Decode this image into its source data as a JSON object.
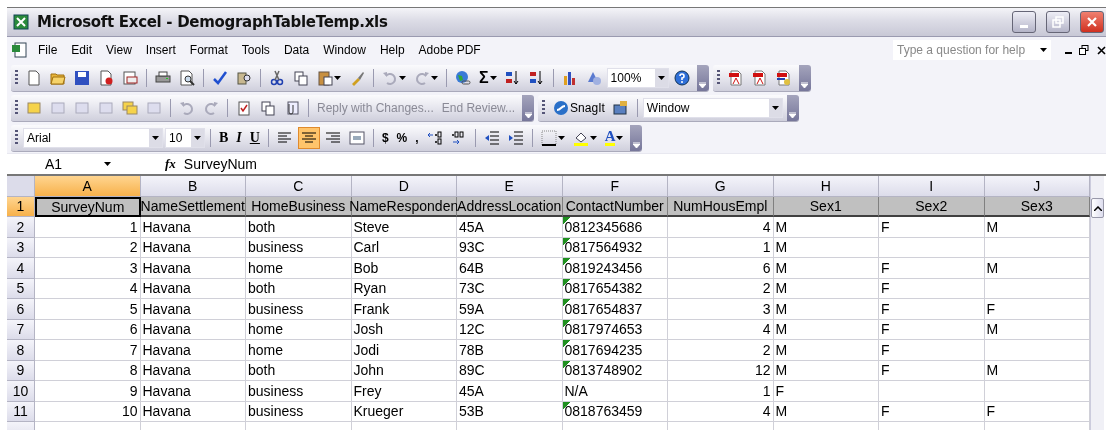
{
  "window": {
    "title": "Microsoft Excel - DemographTableTemp.xls"
  },
  "menu": {
    "items": [
      "File",
      "Edit",
      "View",
      "Insert",
      "Format",
      "Tools",
      "Data",
      "Window",
      "Help",
      "Adobe PDF"
    ],
    "help_search": {
      "placeholder": "Type a question for help"
    }
  },
  "standard_toolbar": {
    "sum": "Σ",
    "zoom": "100%"
  },
  "reviewing_toolbar": {
    "reply": "Reply with Changes...",
    "end_review": "End Review..."
  },
  "snagit_toolbar": {
    "label": "SnagIt",
    "capture_mode": "Window"
  },
  "formatting_toolbar": {
    "font": "Arial",
    "size": "10",
    "bold": "B",
    "italic": "I",
    "underline": "U",
    "alignment": [
      {
        "selected": false
      },
      {
        "selected": true
      },
      {
        "selected": false
      }
    ],
    "currency": "$",
    "percent": "%",
    "comma": ",",
    "font_color": "A"
  },
  "formula_bar": {
    "name_box": "A1",
    "function_label": "fx",
    "value": "SurveyNum"
  },
  "sheet": {
    "columns": [
      {
        "label": "A",
        "selected": true,
        "numeric": true
      },
      {
        "label": "B",
        "selected": false,
        "numeric": false
      },
      {
        "label": "C",
        "selected": false,
        "numeric": false
      },
      {
        "label": "D",
        "selected": false,
        "numeric": false
      },
      {
        "label": "E",
        "selected": false,
        "numeric": false
      },
      {
        "label": "F",
        "selected": false,
        "numeric": false
      },
      {
        "label": "G",
        "selected": false,
        "numeric": true
      },
      {
        "label": "H",
        "selected": false,
        "numeric": false
      },
      {
        "label": "I",
        "selected": false,
        "numeric": false
      },
      {
        "label": "J",
        "selected": false,
        "numeric": false
      }
    ],
    "rows": [
      {
        "number": "1",
        "selected": true,
        "kind": "header",
        "number_stored_as_text": false,
        "cells": [
          "SurveyNum",
          "NameSettlement",
          "HomeBusiness",
          "NameResponden",
          "AddressLocation",
          "ContactNumber",
          "NumHousEmpl",
          "Sex1",
          "Sex2",
          "Sex3"
        ]
      },
      {
        "number": "2",
        "selected": false,
        "kind": "data",
        "number_stored_as_text": true,
        "cells": [
          "1",
          "Havana",
          "both",
          "Steve",
          "45A",
          "0812345686",
          "4",
          "M",
          "F",
          "M"
        ]
      },
      {
        "number": "3",
        "selected": false,
        "kind": "data",
        "number_stored_as_text": true,
        "cells": [
          "2",
          "Havana",
          "business",
          "Carl",
          "93C",
          "0817564932",
          "1",
          "M",
          "",
          ""
        ]
      },
      {
        "number": "4",
        "selected": false,
        "kind": "data",
        "number_stored_as_text": true,
        "cells": [
          "3",
          "Havana",
          "home",
          "Bob",
          "64B",
          "0819243456",
          "6",
          "M",
          "F",
          "M"
        ]
      },
      {
        "number": "5",
        "selected": false,
        "kind": "data",
        "number_stored_as_text": true,
        "cells": [
          "4",
          "Havana",
          "both",
          "Ryan",
          "73C",
          "0817654382",
          "2",
          "M",
          "F",
          ""
        ]
      },
      {
        "number": "6",
        "selected": false,
        "kind": "data",
        "number_stored_as_text": true,
        "cells": [
          "5",
          "Havana",
          "business",
          "Frank",
          "59A",
          "0817654837",
          "3",
          "M",
          "F",
          "F"
        ]
      },
      {
        "number": "7",
        "selected": false,
        "kind": "data",
        "number_stored_as_text": true,
        "cells": [
          "6",
          "Havana",
          "home",
          "Josh",
          "12C",
          "0817974653",
          "4",
          "M",
          "F",
          "M"
        ]
      },
      {
        "number": "8",
        "selected": false,
        "kind": "data",
        "number_stored_as_text": true,
        "cells": [
          "7",
          "Havana",
          "home",
          "Jodi",
          "78B",
          "0817694235",
          "2",
          "M",
          "F",
          ""
        ]
      },
      {
        "number": "9",
        "selected": false,
        "kind": "data",
        "number_stored_as_text": true,
        "cells": [
          "8",
          "Havana",
          "both",
          "John",
          "89C",
          "0813748902",
          "12",
          "M",
          "F",
          "M"
        ]
      },
      {
        "number": "10",
        "selected": false,
        "kind": "data",
        "number_stored_as_text": false,
        "cells": [
          "9",
          "Havana",
          "business",
          "Frey",
          "45A",
          "N/A",
          "1",
          "F",
          "",
          ""
        ]
      },
      {
        "number": "11",
        "selected": false,
        "kind": "data",
        "number_stored_as_text": true,
        "cells": [
          "10",
          "Havana",
          "business",
          "Krueger",
          "53B",
          "0818763459",
          "4",
          "M",
          "F",
          "F"
        ]
      }
    ]
  }
}
